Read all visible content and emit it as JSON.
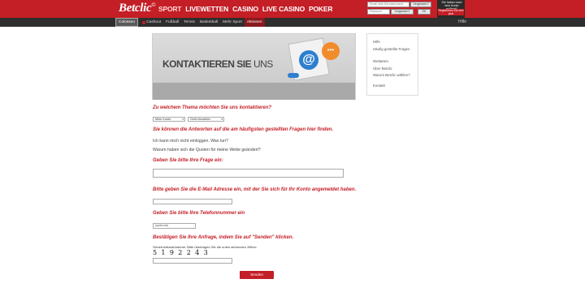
{
  "header": {
    "logo": "Betclic",
    "nav": [
      "SPORT",
      "LIVEWETTEN",
      "CASINO",
      "LIVE CASINO",
      "POKER"
    ],
    "login": {
      "username_placeholder": "Email oder Benutzername",
      "forgot1": "Vergessen?",
      "password_placeholder": "Passwort",
      "forgot2": "Vergessen?",
      "ok": "OK"
    },
    "konto": {
      "text": "Sie haben noch kein Konto eröffnet?",
      "cta": "Registrieren Sie sich jetzt"
    }
  },
  "subnav": {
    "items": [
      {
        "label": "Kalender",
        "icon": "calendar-icon"
      },
      {
        "label": "Cashout",
        "icon": "cashout-icon"
      },
      {
        "label": "Fußball"
      },
      {
        "label": "Tennis"
      },
      {
        "label": "Basketball"
      },
      {
        "label": "Mehr Sport"
      },
      {
        "label": "Colosseo"
      },
      {
        "label": "Aktionen"
      }
    ],
    "help": "Hilfe"
  },
  "banner": {
    "title_bold": "KONTAKTIEREN SIE",
    "title_light": "UNS",
    "bubble": "•••",
    "at": "@"
  },
  "sidebar": {
    "links": [
      "Hilfe",
      "Häufig gestellte Fragen",
      "Wettarten",
      "Über Betclic",
      "Warum Betclic wählen?",
      "Kontakt"
    ]
  },
  "form": {
    "q_topic": "Zu welchem Thema möchten Sie uns kontaktieren?",
    "select_topic": "Mein Konto",
    "select_sub": "Geld einzahlen",
    "faq_hint": "Sie können die Antworten auf die am häufigsten gestellten Fragen hier finden.",
    "faq1": "Ich kann mich nicht einloggen. Was tun?",
    "faq2": "Warum haben sich die Quoten für meine Wette geändert?",
    "q_question": "Geben Sie bitte Ihre Frage ein:",
    "q_email": "Bitte geben Sie die E-Mail Adresse ein, mit der Sie sich für Ihr Konto angemeldet haben.",
    "q_phone": "Geben Sie bitte Ihre Telefonnummer ein",
    "phone_placeholder": "(optional)",
    "q_confirm": "Bestätigen Sie Ihre Anfrage, indem Sie auf \"Senden\" klicken.",
    "captcha_label": "Sicherheitsmaßnahme: Bitte übertragen Sie die unten stehenden Ziffern:",
    "captcha_code": "5 1 9 2 2 4 3",
    "send": "Senden"
  },
  "colors": {
    "brand_red": "#c41e26",
    "subbar": "#2e2e2e"
  }
}
